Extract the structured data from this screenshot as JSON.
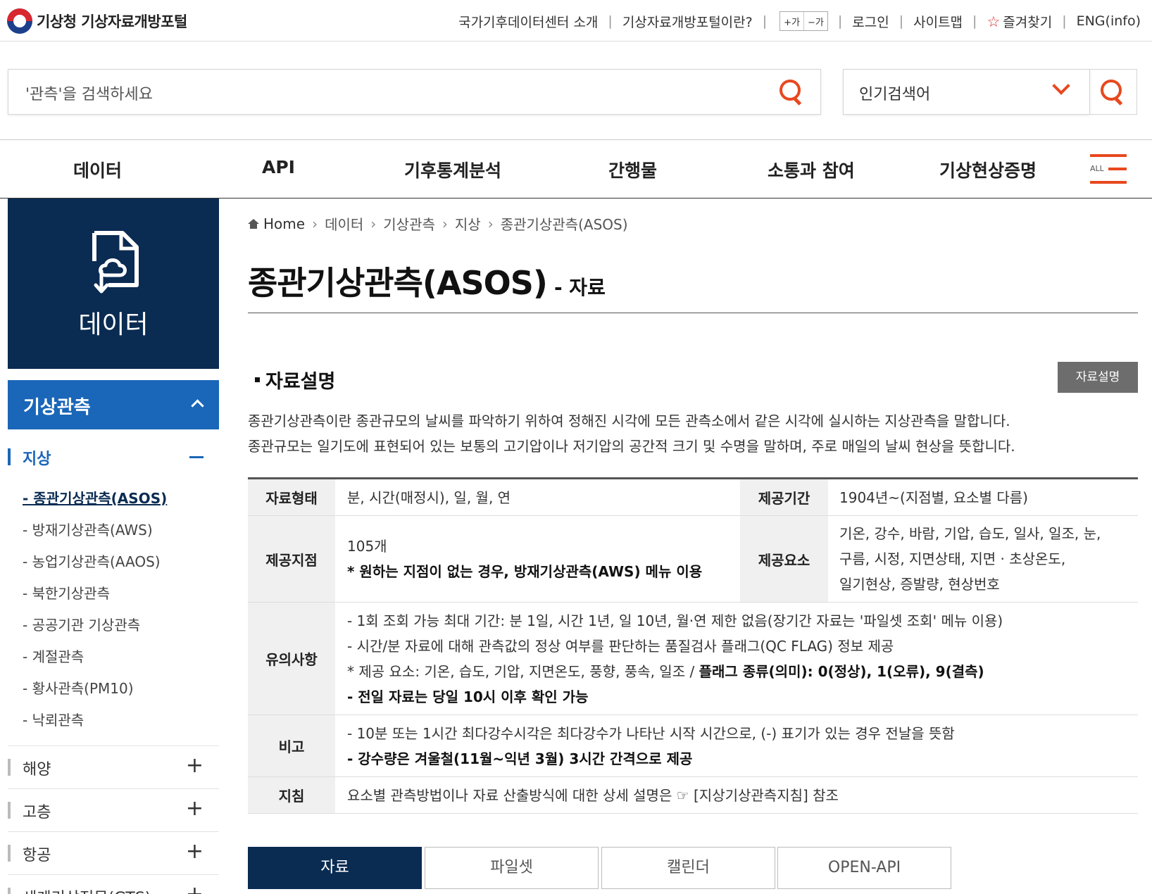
{
  "header": {
    "logo_text": "기상청 기상자료개방포털",
    "utils": {
      "about_climate": "국가기후데이터센터 소개",
      "about_portal": "기상자료개방포털이란?",
      "font_plus": "+가",
      "font_minus": "−가",
      "login": "로그인",
      "sitemap": "사이트맵",
      "favorites": "즐겨찾기",
      "eng": "ENG(info)"
    }
  },
  "search": {
    "placeholder": "'관측'을 검색하세요",
    "popular_label": "인기검색어"
  },
  "gnb": {
    "items": [
      "데이터",
      "API",
      "기후통계분석",
      "간행물",
      "소통과 참여",
      "기상현상증명"
    ],
    "all_label": "ALL"
  },
  "sidebar": {
    "title": "데이터",
    "category": "기상관측",
    "active_sub": "지상",
    "ground_items": [
      "- 종관기상관측(ASOS)",
      "- 방재기상관측(AWS)",
      "- 농업기상관측(AAOS)",
      "- 북한기상관측",
      "- 공공기관 기상관측",
      "- 계절관측",
      "- 황사관측(PM10)",
      "- 낙뢰관측"
    ],
    "other_subs": [
      "해양",
      "고층",
      "항공",
      "세계기상전문(GTS)"
    ]
  },
  "breadcrumb": [
    "Home",
    "데이터",
    "기상관측",
    "지상",
    "종관기상관측(ASOS)"
  ],
  "page": {
    "title": "종관기상관측(ASOS)",
    "title_suffix": "- 자료"
  },
  "section": {
    "title": "자료설명",
    "desc_button": "자료설명",
    "intro_lines": [
      "종관기상관측이란 종관규모의 날씨를 파악하기 위하여 정해진 시각에 모든 관측소에서 같은 시각에 실시하는 지상관측을 말합니다.",
      "종관규모는 일기도에 표현되어 있는 보통의 고기압이나 저기압의 공간적 크기 및 수명을 말하며, 주로 매일의 날씨 현상을 뜻합니다."
    ]
  },
  "table": {
    "type_th": "자료형태",
    "type_td": "분, 시간(매정시), 일, 월, 연",
    "period_th": "제공기간",
    "period_td": "1904년~(지점별, 요소별 다름)",
    "station_th": "제공지점",
    "station_count": "105개",
    "station_note": "* 원하는 지점이 없는 경우, 방재기상관측(AWS) 메뉴 이용",
    "elements_th": "제공요소",
    "elements_lines": [
      "기온, 강수, 바람, 기압, 습도, 일사, 일조, 눈,",
      "구름, 시정, 지면상태, 지면 · 초상온도,",
      "일기현상, 증발량, 현상번호"
    ],
    "notes_th": "유의사항",
    "notes_line1": "- 1회 조회 가능 최대 기간: 분 1일, 시간 1년, 일 10년, 월·연 제한 없음(장기간 자료는 '파일셋 조회' 메뉴 이용)",
    "notes_line2": "- 시간/분 자료에 대해 관측값의 정상 여부를 판단하는 품질검사 플래그(QC FLAG) 정보 제공",
    "notes_line3_normal": "* 제공 요소: 기온, 습도, 기압, 지면온도, 풍향, 풍속, 일조 / ",
    "notes_line3_bold": "플래그 종류(의미): 0(정상), 1(오류), 9(결측)",
    "notes_line4": "- 전일 자료는 당일 10시 이후 확인 가능",
    "remarks_th": "비고",
    "remarks_line1": "- 10분 또는 1시간 최다강수시각은 최다강수가 나타난 시작 시간으로, (-) 표기가 있는 경우 전날을 뜻함",
    "remarks_line2": "- 강수량은 겨울철(11월~익년 3월) 3시간 간격으로 제공",
    "guide_th": "지침",
    "guide_td": "요소별 관측방법이나 자료 산출방식에 대한 상세 설명은 ☞ [지상기상관측지침] 참조"
  },
  "tabs": [
    "자료",
    "파일셋",
    "캘린더",
    "OPEN-API"
  ],
  "colors": {
    "navy": "#0a2b52",
    "blue": "#1a66b8",
    "accent": "#e8481e"
  }
}
